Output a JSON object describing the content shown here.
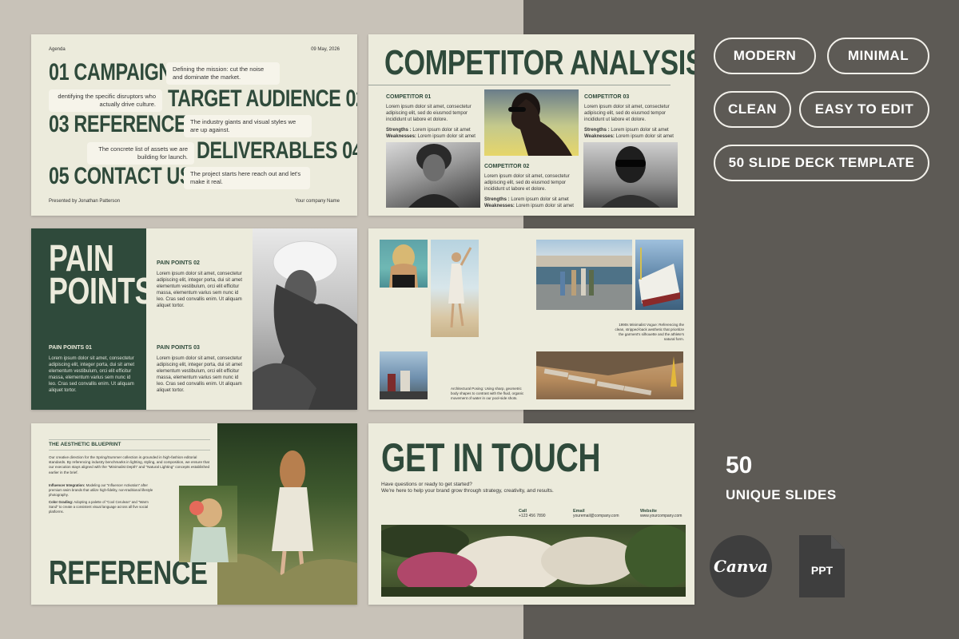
{
  "slide1": {
    "header_left": "Agenda",
    "header_right": "09 May, 2026",
    "items": [
      {
        "title": "01 CAMPAIGN",
        "desc": "Defining the mission: cut the noise and dominate the market."
      },
      {
        "title": "TARGET AUDIENCE 02",
        "desc": "dentifying the specific disruptors who actually drive culture."
      },
      {
        "title": "03 REFERENCES",
        "desc": "The industry giants and visual styles we are up against."
      },
      {
        "title": "DELIVERABLES 04",
        "desc": "The concrete list of assets we are building for launch."
      },
      {
        "title": "05 CONTACT US",
        "desc": "The project starts here reach out and let's make it real."
      }
    ],
    "footer_left": "Presented by Jonathan Patterson",
    "footer_right": "Your company Name"
  },
  "slide2": {
    "title": "COMPETITOR ANALYSIS",
    "c1_title": "COMPETITOR 01",
    "c2_title": "COMPETITOR 02",
    "c3_title": "COMPETITOR 03",
    "body": "Lorem ipsum dolor sit amet, consectetur adipiscing elit, sed do eiusmod tempor incididunt ut labore et dolore.",
    "strengths_label": "Strengths :",
    "strengths_text": "Lorem ipsum dolor sit amet",
    "weakness_label": "Weaknesses:",
    "weakness_text": "Lorem ipsum dolor sit amet"
  },
  "slide3": {
    "title_line1": "PAIN",
    "title_line2": "POINTS",
    "p1_title": "PAIN POINTS 01",
    "p2_title": "PAIN POINTS 02",
    "p3_title": "PAIN POINTS 03",
    "body": "Lorem ipsum dolor sit amet, consectetur adipiscing elit, integer porta, dui sit amet elementum vestibulum, orci elit efficitur massa, elementum varius sem nunc id leo. Cras sed convallis enim. Ut aliquam aliquet tortor."
  },
  "slide4": {
    "caption1": "1990s Minimalist Vogue: Referencing the clean, stripped-back aesthetic that prioritize the garment's silhouette and the athlete's natural form.",
    "caption2": "Architectural Posing: Using sharp, geometric body shapes to contrast with the fluid, organic movement of water in our pool-side shots."
  },
  "slide5": {
    "title": "THE AESTHETIC BLUEPRINT",
    "para1": "Our creative direction for the Spring/Summer collection is grounded in high-fashion editorial standards. By referencing industry benchmarks in lighting, styling, and composition, we ensure that our execution stays aligned with the \"Minimalist Depth\" and \"Natural Lighting\" concepts established earlier in the brief.",
    "para2_label": "Influencer Integration:",
    "para2": "Modeling our \"Influencer Activation\" after premium swim brands that utilize high-fidelity, non-traditional lifestyle photography.",
    "para3_label": "Color Grading:",
    "para3": "Adopting a palette of \"Cool Cerulean\" and \"Warm Sand\" to create a consistent visual language across all five social platforms.",
    "big_title": "REFERENCE"
  },
  "slide6": {
    "title": "GET IN TOUCH",
    "sub1": "Have questions or ready to get started?",
    "sub2": "We're here to help your brand grow through strategy, creativity, and results.",
    "call_label": "Call",
    "call_value": "+123 456 7890",
    "email_label": "Email",
    "email_value": "youremail@company.com",
    "web_label": "Website",
    "web_value": "www.yourcompany.com"
  },
  "tags": [
    "MODERN",
    "MINIMAL",
    "CLEAN",
    "EASY TO EDIT",
    "50 SLIDE DECK TEMPLATE"
  ],
  "count": "50",
  "count_label": "UNIQUE SLIDES",
  "canva_label": "Canva",
  "ppt_label": "PPT",
  "colors": {
    "accent_green": "#2f4a3b",
    "slide_bg": "#ecebdc",
    "right_bg": "#5d5a55",
    "left_bg": "#c8c2b8"
  }
}
